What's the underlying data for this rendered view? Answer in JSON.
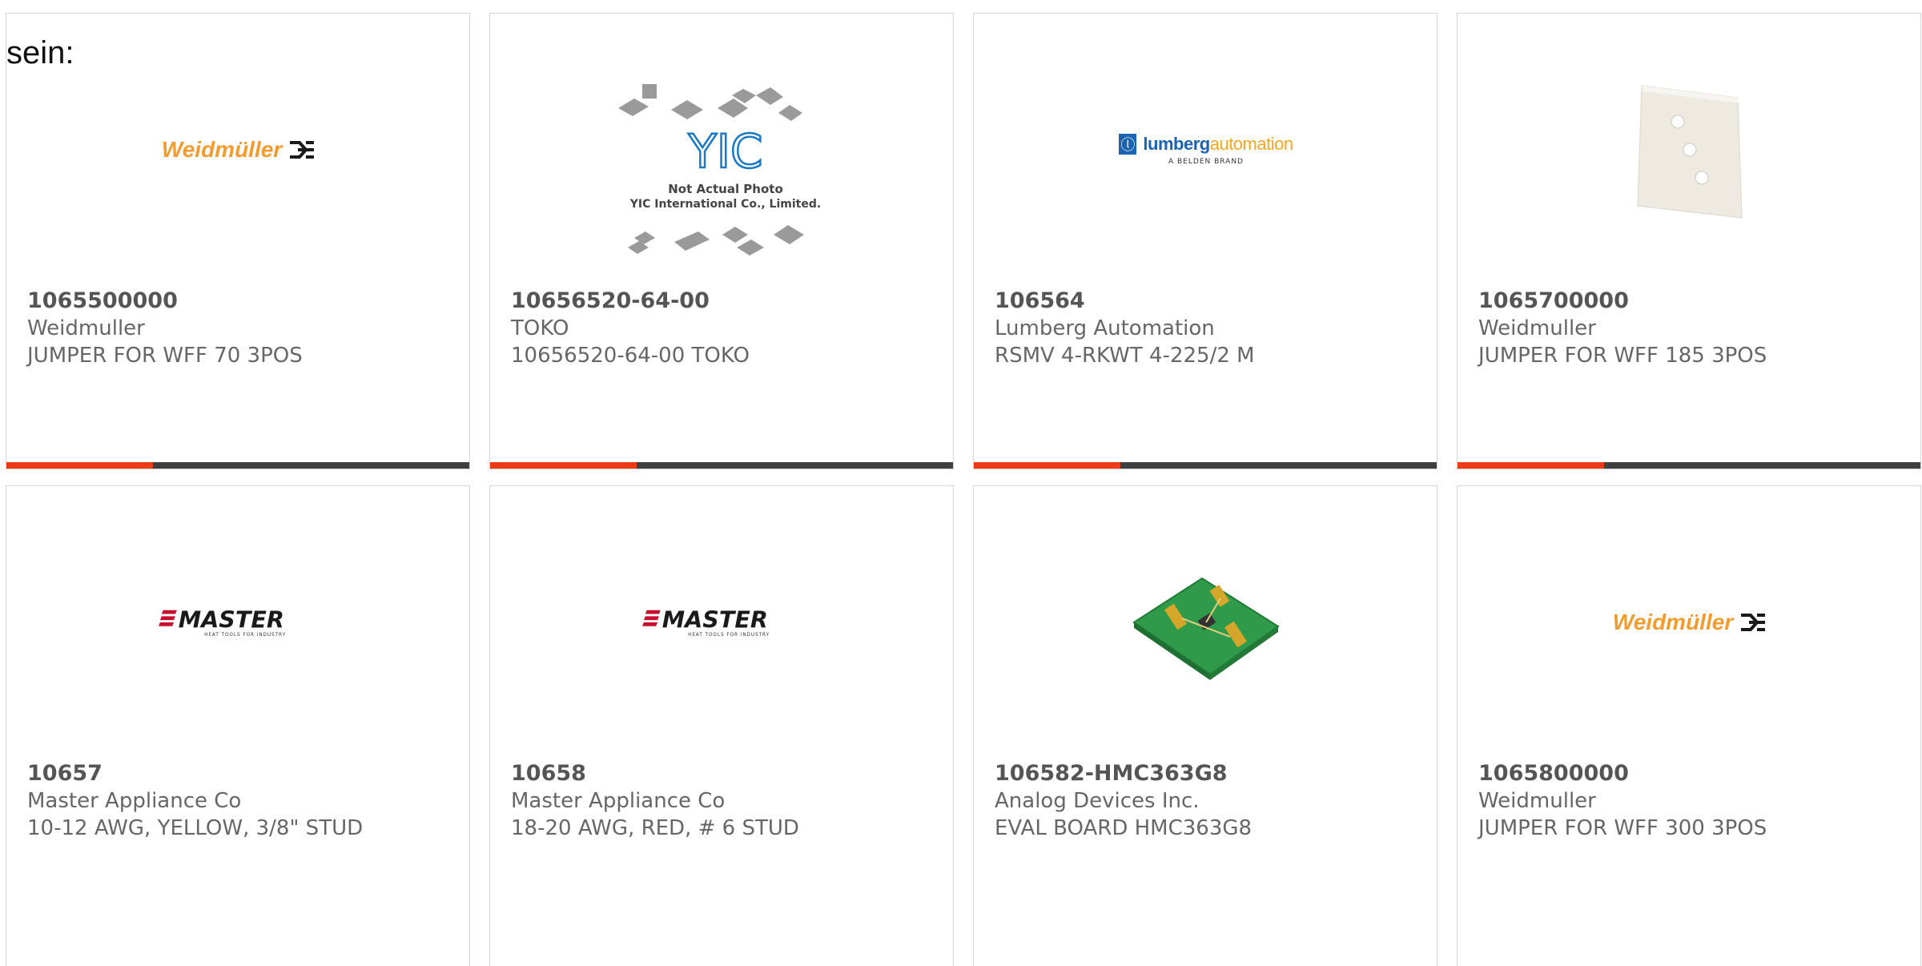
{
  "page": {
    "heading": "sein:"
  },
  "brand_colors": {
    "accent_bar": "#ee3a16",
    "bar_track": "#3f3f3f",
    "weidmuller_orange": "#f29b2f",
    "master_red": "#c8102e",
    "lumberg_blue": "#1a63b0"
  },
  "cards": [
    {
      "part_number": "1065500000",
      "manufacturer": "Weidmuller",
      "description": "JUMPER FOR WFF 70 3POS",
      "image": "weidmuller-logo",
      "logo_text": "Weidmüller"
    },
    {
      "part_number": "10656520-64-00",
      "manufacturer": "TOKO",
      "description": "10656520-64-00 TOKO",
      "image": "yic-placeholder",
      "logo_text": "YIC",
      "photo_note": "Not Actual Photo",
      "photo_company": "YIC International Co., Limited."
    },
    {
      "part_number": "106564",
      "manufacturer": "Lumberg Automation",
      "description": "RSMV 4-RKWT 4-225/2 M",
      "image": "lumberg-automation-logo",
      "logo_text_main": "lumberg",
      "logo_text_accent": "automation",
      "logo_subtext": "A BELDEN BRAND"
    },
    {
      "part_number": "1065700000",
      "manufacturer": "Weidmuller",
      "description": "JUMPER FOR WFF 185 3POS",
      "image": "jumper-bar-photo"
    },
    {
      "part_number": "10657",
      "manufacturer": "Master Appliance Co",
      "description": "10-12 AWG, YELLOW, 3/8\" STUD",
      "image": "master-logo",
      "logo_text": "MASTER",
      "logo_subtext": "HEAT TOOLS FOR INDUSTRY"
    },
    {
      "part_number": "10658",
      "manufacturer": "Master Appliance Co",
      "description": "18-20 AWG, RED, # 6 STUD",
      "image": "master-logo",
      "logo_text": "MASTER",
      "logo_subtext": "HEAT TOOLS FOR INDUSTRY"
    },
    {
      "part_number": "106582-HMC363G8",
      "manufacturer": "Analog Devices Inc.",
      "description": "EVAL BOARD HMC363G8",
      "image": "eval-board-photo"
    },
    {
      "part_number": "1065800000",
      "manufacturer": "Weidmuller",
      "description": "JUMPER FOR WFF 300 3POS",
      "image": "weidmuller-logo",
      "logo_text": "Weidmüller"
    }
  ]
}
